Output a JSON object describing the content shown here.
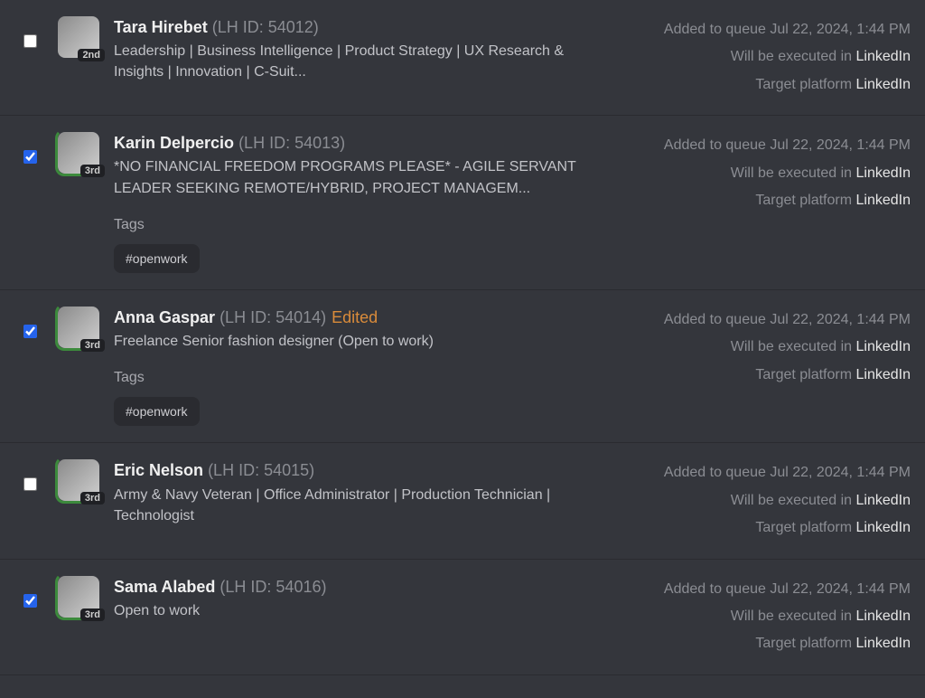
{
  "labels": {
    "lhid_prefix": "(LH ID: ",
    "lhid_suffix": ")",
    "added": "Added to queue ",
    "executed": "Will be executed in ",
    "target": "Target platform ",
    "tags": "Tags",
    "edited": "Edited"
  },
  "rows": [
    {
      "name": "Tara Hirebet",
      "lhid": "54012",
      "conn": "2nd",
      "open_to_work": false,
      "checked": false,
      "edited": false,
      "headline": "Leadership | Business Intelligence | Product Strategy | UX Research & Insights | Innovation | C-Suit...",
      "tags": [],
      "added": "Jul 22, 2024, 1:44 PM",
      "exec_platform": "LinkedIn",
      "target_platform": "LinkedIn"
    },
    {
      "name": "Karin Delpercio",
      "lhid": "54013",
      "conn": "3rd",
      "open_to_work": true,
      "checked": true,
      "edited": false,
      "headline": "*NO FINANCIAL FREEDOM PROGRAMS PLEASE* - AGILE SERVANT LEADER SEEKING REMOTE/HYBRID, PROJECT MANAGEM...",
      "tags": [
        "#openwork"
      ],
      "added": "Jul 22, 2024, 1:44 PM",
      "exec_platform": "LinkedIn",
      "target_platform": "LinkedIn"
    },
    {
      "name": "Anna Gaspar",
      "lhid": "54014",
      "conn": "3rd",
      "open_to_work": true,
      "checked": true,
      "edited": true,
      "headline": "Freelance Senior fashion designer (Open to work)",
      "tags": [
        "#openwork"
      ],
      "added": "Jul 22, 2024, 1:44 PM",
      "exec_platform": "LinkedIn",
      "target_platform": "LinkedIn"
    },
    {
      "name": "Eric Nelson",
      "lhid": "54015",
      "conn": "3rd",
      "open_to_work": true,
      "checked": false,
      "edited": false,
      "headline": "Army & Navy Veteran | Office Administrator | Production Technician | Technologist",
      "tags": [],
      "added": "Jul 22, 2024, 1:44 PM",
      "exec_platform": "LinkedIn",
      "target_platform": "LinkedIn"
    },
    {
      "name": "Sama Alabed",
      "lhid": "54016",
      "conn": "3rd",
      "open_to_work": true,
      "checked": true,
      "edited": false,
      "headline": "Open to work",
      "tags": [],
      "added": "Jul 22, 2024, 1:44 PM",
      "exec_platform": "LinkedIn",
      "target_platform": "LinkedIn"
    }
  ]
}
